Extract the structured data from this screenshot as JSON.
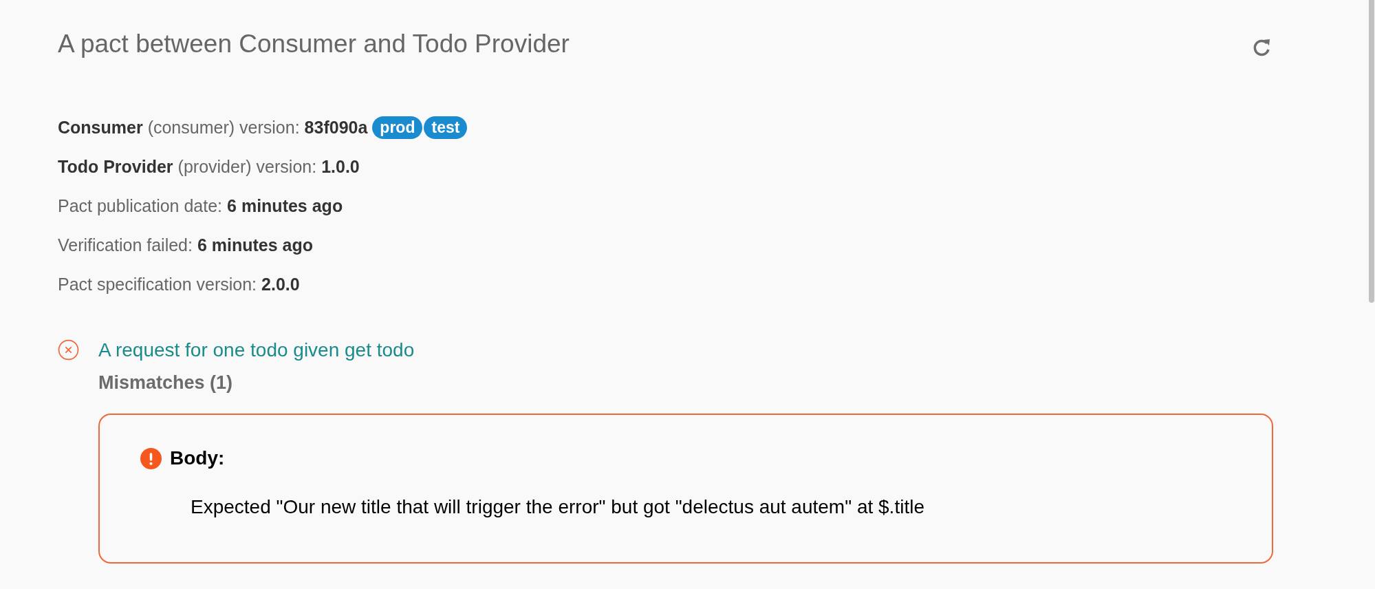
{
  "title": "A pact between Consumer and Todo Provider",
  "parties": [
    {
      "name": "Consumer",
      "role": "(consumer)",
      "label": "version:",
      "version": "83f090a",
      "tags": [
        "prod",
        "test"
      ]
    },
    {
      "name": "Todo Provider",
      "role": "(provider)",
      "label": "version:",
      "version": "1.0.0"
    }
  ],
  "details": [
    {
      "label": "Pact publication date:",
      "value": "6 minutes ago"
    },
    {
      "label": "Verification failed:",
      "value": "6 minutes ago"
    },
    {
      "label": "Pact specification version:",
      "value": "2.0.0"
    }
  ],
  "interactions": [
    {
      "failed": true,
      "description": "A request for one todo given get todo",
      "mismatches_heading": "Mismatches (1)",
      "mismatches": [
        {
          "heading": "Body:",
          "message": "Expected \"Our new title that will trigger the error\" but got \"delectus aut autem\" at $.title"
        }
      ]
    }
  ]
}
